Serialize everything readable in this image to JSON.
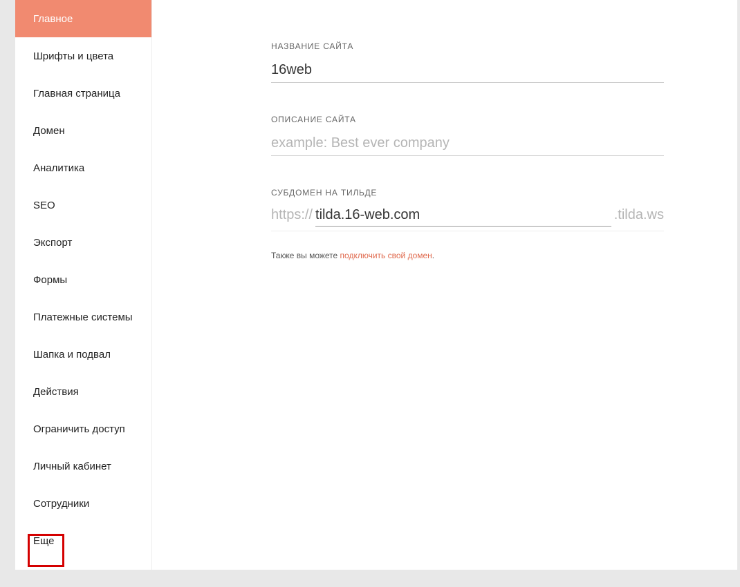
{
  "sidebar": {
    "items": [
      {
        "label": "Главное",
        "active": true
      },
      {
        "label": "Шрифты и цвета",
        "active": false
      },
      {
        "label": "Главная страница",
        "active": false
      },
      {
        "label": "Домен",
        "active": false
      },
      {
        "label": "Аналитика",
        "active": false
      },
      {
        "label": "SEO",
        "active": false
      },
      {
        "label": "Экспорт",
        "active": false
      },
      {
        "label": "Формы",
        "active": false
      },
      {
        "label": "Платежные системы",
        "active": false
      },
      {
        "label": "Шапка и подвал",
        "active": false
      },
      {
        "label": "Действия",
        "active": false
      },
      {
        "label": "Ограничить доступ",
        "active": false
      },
      {
        "label": "Личный кабинет",
        "active": false
      },
      {
        "label": "Сотрудники",
        "active": false
      },
      {
        "label": "Еще",
        "active": false
      }
    ]
  },
  "form": {
    "site_name": {
      "label": "НАЗВАНИЕ САЙТА",
      "value": "16web"
    },
    "site_description": {
      "label": "ОПИСАНИЕ САЙТА",
      "value": "",
      "placeholder": "example: Best ever company"
    },
    "subdomain": {
      "label": "СУБДОМЕН НА ТИЛЬДЕ",
      "prefix": "https://",
      "value": "tilda.16-web.com",
      "suffix": ".tilda.ws"
    },
    "hint": {
      "prefix": "Также вы можете ",
      "link": "подключить свой домен",
      "suffix": "."
    }
  }
}
